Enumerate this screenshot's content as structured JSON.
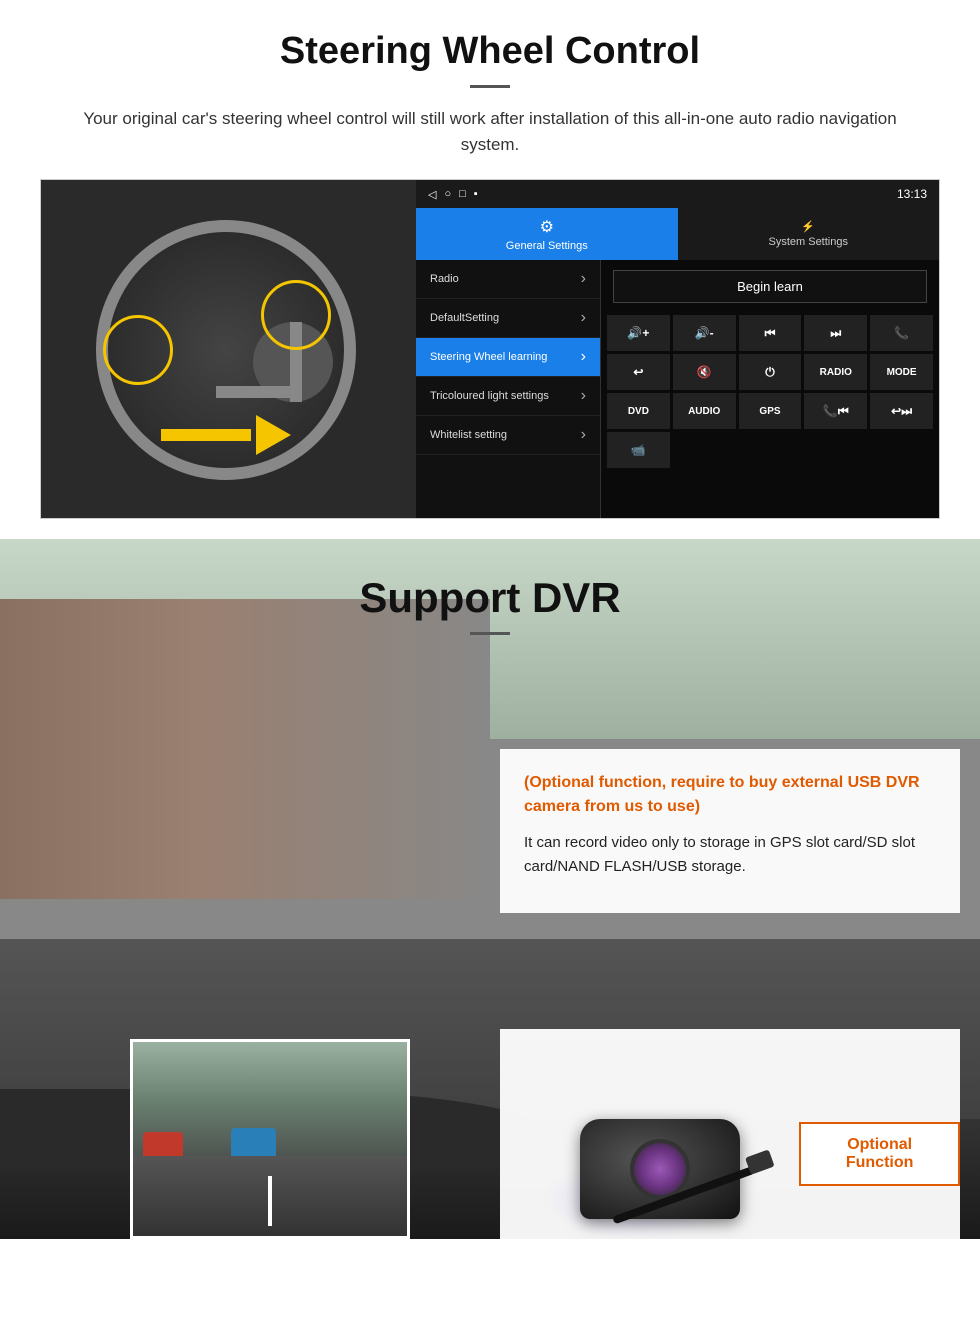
{
  "steering_section": {
    "title": "Steering Wheel Control",
    "description": "Your original car's steering wheel control will still work after installation of this all-in-one auto radio navigation system.",
    "statusbar": {
      "time": "13:13",
      "icons": [
        "◁",
        "○",
        "□",
        "▪"
      ]
    },
    "tabs": {
      "general": "General Settings",
      "system": "System Settings"
    },
    "menu_items": [
      {
        "label": "Radio",
        "active": false
      },
      {
        "label": "DefaultSetting",
        "active": false
      },
      {
        "label": "Steering Wheel learning",
        "active": true
      },
      {
        "label": "Tricoloured light settings",
        "active": false
      },
      {
        "label": "Whitelist setting",
        "active": false
      }
    ],
    "begin_learn_label": "Begin learn",
    "control_buttons": [
      "🔊+",
      "🔊-",
      "⏮",
      "⏭",
      "📞",
      "↩",
      "🔇",
      "⏻",
      "RADIO",
      "MODE",
      "DVD",
      "AUDIO",
      "GPS",
      "📞⏮",
      "↩⏭"
    ]
  },
  "dvr_section": {
    "title": "Support DVR",
    "optional_text": "(Optional function, require to buy external USB DVR camera from us to use)",
    "description": "It can record video only to storage in GPS slot card/SD slot card/NAND FLASH/USB storage.",
    "optional_button_label": "Optional Function"
  }
}
